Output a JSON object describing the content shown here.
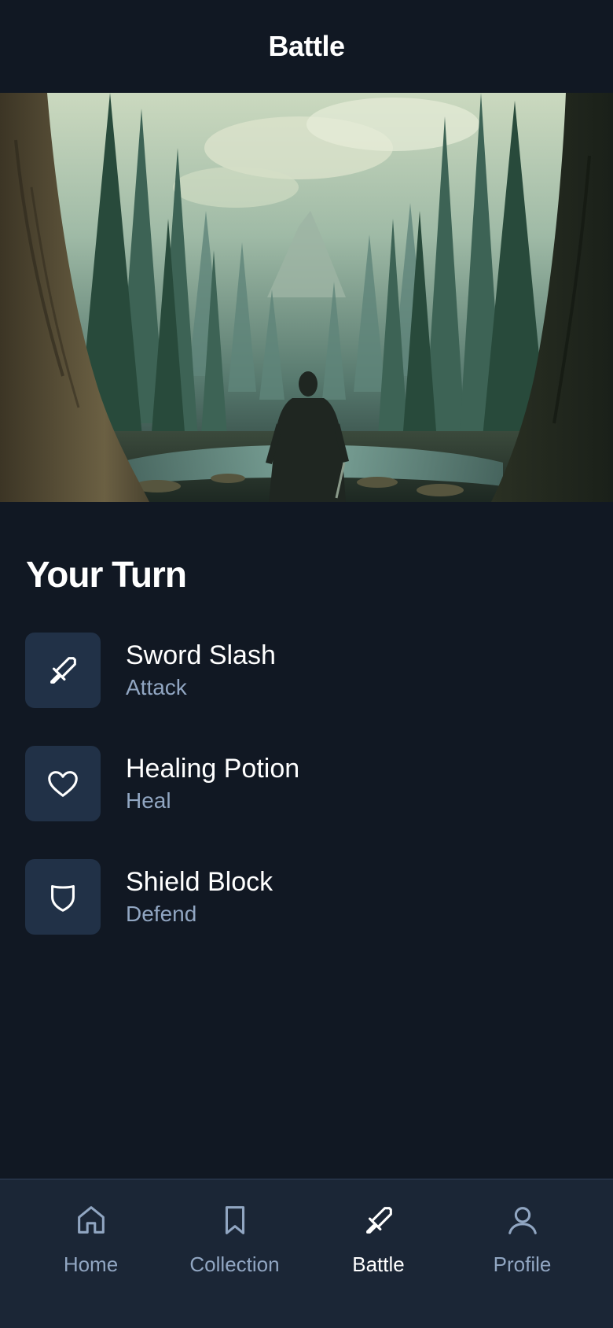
{
  "header": {
    "title": "Battle"
  },
  "turn": {
    "title": "Your Turn"
  },
  "actions": [
    {
      "name": "Sword Slash",
      "type": "Attack",
      "icon": "sword-icon"
    },
    {
      "name": "Healing Potion",
      "type": "Heal",
      "icon": "heart-icon"
    },
    {
      "name": "Shield Block",
      "type": "Defend",
      "icon": "shield-icon"
    }
  ],
  "nav": {
    "items": [
      {
        "label": "Home",
        "icon": "home-icon",
        "active": false
      },
      {
        "label": "Collection",
        "icon": "bookmark-icon",
        "active": false
      },
      {
        "label": "Battle",
        "icon": "sword-icon",
        "active": true
      },
      {
        "label": "Profile",
        "icon": "user-icon",
        "active": false
      }
    ]
  },
  "colors": {
    "background": "#111823",
    "surface": "#1b2636",
    "icon_tile": "#213147",
    "muted_text": "#91a6c2",
    "primary_text": "#ffffff"
  }
}
